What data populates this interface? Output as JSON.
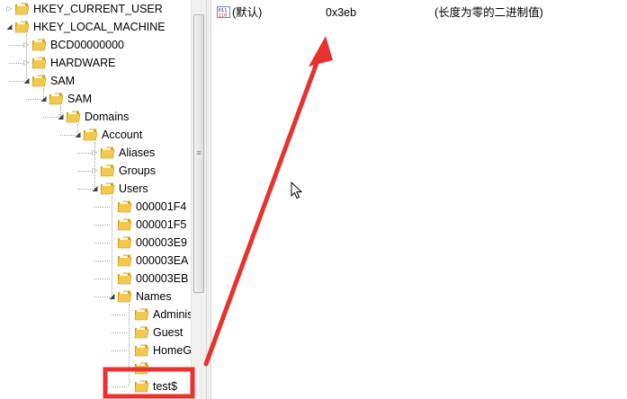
{
  "tree": {
    "items": [
      {
        "label": "HKEY_CURRENT_USER",
        "level": 0,
        "state": "collapsed"
      },
      {
        "label": "HKEY_LOCAL_MACHINE",
        "level": 0,
        "state": "expanded"
      },
      {
        "label": "BCD00000000",
        "level": 1,
        "state": "collapsed"
      },
      {
        "label": "HARDWARE",
        "level": 1,
        "state": "collapsed"
      },
      {
        "label": "SAM",
        "level": 1,
        "state": "expanded"
      },
      {
        "label": "SAM",
        "level": 2,
        "state": "expanded"
      },
      {
        "label": "Domains",
        "level": 3,
        "state": "expanded"
      },
      {
        "label": "Account",
        "level": 4,
        "state": "expanded"
      },
      {
        "label": "Aliases",
        "level": 5,
        "state": "collapsed"
      },
      {
        "label": "Groups",
        "level": 5,
        "state": "collapsed"
      },
      {
        "label": "Users",
        "level": 5,
        "state": "expanded"
      },
      {
        "label": "000001F4",
        "level": 6,
        "state": "leaf"
      },
      {
        "label": "000001F5",
        "level": 6,
        "state": "leaf"
      },
      {
        "label": "000003E9",
        "level": 6,
        "state": "leaf"
      },
      {
        "label": "000003EA",
        "level": 6,
        "state": "leaf"
      },
      {
        "label": "000003EB",
        "level": 6,
        "state": "leaf"
      },
      {
        "label": "Names",
        "level": 6,
        "state": "expanded"
      },
      {
        "label": "Administr",
        "level": 7,
        "state": "leaf"
      },
      {
        "label": "Guest",
        "level": 7,
        "state": "leaf"
      },
      {
        "label": "HomeGro",
        "level": 7,
        "state": "leaf"
      },
      {
        "label": "",
        "level": 7,
        "state": "leaf"
      },
      {
        "label": "test$",
        "level": 7,
        "state": "leaf"
      }
    ]
  },
  "values": {
    "rows": [
      {
        "icon": "binary-value-icon",
        "name": "(默认)",
        "data": "0x3eb",
        "desc": "(长度为零的二进制值)"
      }
    ]
  },
  "colors": {
    "annotation_red": "#e8322f",
    "folder_yellow": "#f2c94c",
    "folder_dark": "#d4a017"
  }
}
